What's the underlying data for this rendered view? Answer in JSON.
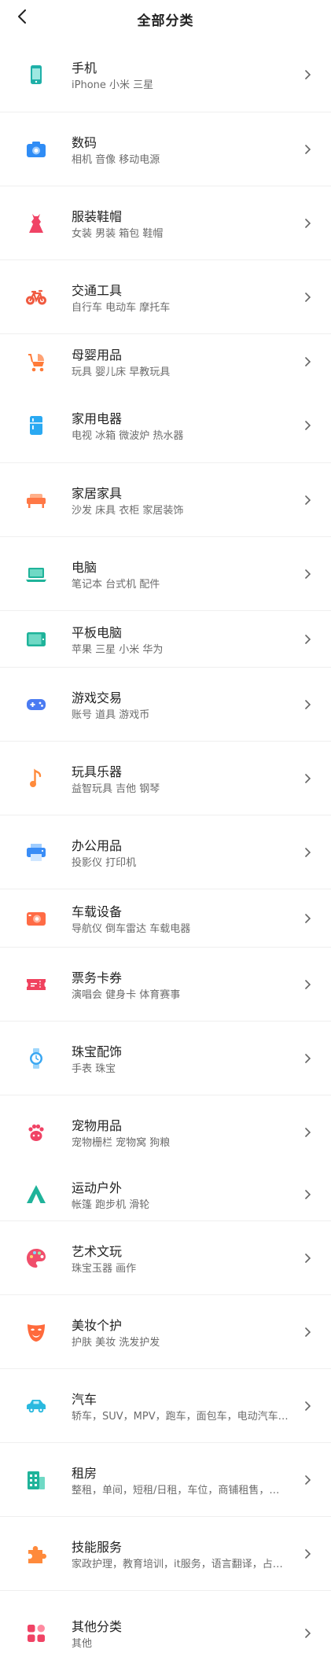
{
  "header": {
    "title": "全部分类",
    "back_icon": "back-chevron-icon"
  },
  "colors": {
    "phone": "#1fb0a8",
    "camera": "#2f8cf5",
    "clothes": "#f04365",
    "bike": "#f05a40",
    "baby": "#ff7b39",
    "appliance": "#2aa9f2",
    "furniture": "#ff7846",
    "pc": "#1fb39a",
    "tablet": "#1fb39a",
    "game": "#4a7bf2",
    "music": "#ff8a3b",
    "printer": "#3a8df6",
    "car_device": "#ff6b45",
    "ticket": "#f0425e",
    "watch": "#3aa7f2",
    "pet": "#f04365",
    "outdoor": "#1fb39a",
    "art": "#f04e6b",
    "mask": "#ff6a3c",
    "car": "#2ab9df",
    "house": "#1fb39a",
    "skill": "#ff8a3b",
    "other": "#f04365"
  },
  "categories": [
    {
      "name": "手机",
      "sub": "iPhone 小米 三星",
      "icon": "smartphone-icon"
    },
    {
      "name": "数码",
      "sub": "相机 音像 移动电源",
      "icon": "camera-icon"
    },
    {
      "name": "服装鞋帽",
      "sub": "女装 男装 箱包 鞋帽",
      "icon": "dress-icon"
    },
    {
      "name": "交通工具",
      "sub": "自行车 电动车 摩托车",
      "icon": "bicycle-icon"
    },
    {
      "name": "母婴用品",
      "sub": "玩具 婴儿床 早教玩具",
      "icon": "stroller-icon"
    },
    {
      "name": "家用电器",
      "sub": "电视 冰箱 微波炉 热水器",
      "icon": "fridge-icon"
    },
    {
      "name": "家居家具",
      "sub": "沙发 床具 衣柜 家居装饰",
      "icon": "sofa-icon"
    },
    {
      "name": "电脑",
      "sub": "笔记本 台式机 配件",
      "icon": "laptop-icon"
    },
    {
      "name": "平板电脑",
      "sub": "苹果 三星 小米 华为",
      "icon": "tablet-icon"
    },
    {
      "name": "游戏交易",
      "sub": "账号 道具 游戏币",
      "icon": "gamepad-icon"
    },
    {
      "name": "玩具乐器",
      "sub": "益智玩具 吉他 钢琴",
      "icon": "music-note-icon"
    },
    {
      "name": "办公用品",
      "sub": "投影仪 打印机",
      "icon": "printer-icon"
    },
    {
      "name": "车载设备",
      "sub": "导航仪 倒车雷达 车载电器",
      "icon": "dashcam-icon"
    },
    {
      "name": "票务卡券",
      "sub": "演唱会 健身卡 体育赛事",
      "icon": "ticket-icon"
    },
    {
      "name": "珠宝配饰",
      "sub": "手表 珠宝",
      "icon": "watch-icon"
    },
    {
      "name": "宠物用品",
      "sub": "宠物栅栏 宠物窝 狗粮",
      "icon": "paw-icon"
    },
    {
      "name": "运动户外",
      "sub": "帐篷 跑步机 滑轮",
      "icon": "tent-icon"
    },
    {
      "name": "艺术文玩",
      "sub": "珠宝玉器 画作",
      "icon": "palette-icon"
    },
    {
      "name": "美妆个护",
      "sub": "护肤 美妆 洗发护发",
      "icon": "mask-icon"
    },
    {
      "name": "汽车",
      "sub": "轿车，SUV，MPV，跑车，面包车，电动汽车…",
      "icon": "car-icon"
    },
    {
      "name": "租房",
      "sub": "整租，单间，短租/日租，车位，商铺租售，…",
      "icon": "building-icon"
    },
    {
      "name": "技能服务",
      "sub": "家政护理，教育培训，it服务，语言翻译，占…",
      "icon": "puzzle-icon"
    },
    {
      "name": "其他分类",
      "sub": "其他",
      "icon": "grid-icon"
    }
  ],
  "chevron_icon": "chevron-right-icon"
}
